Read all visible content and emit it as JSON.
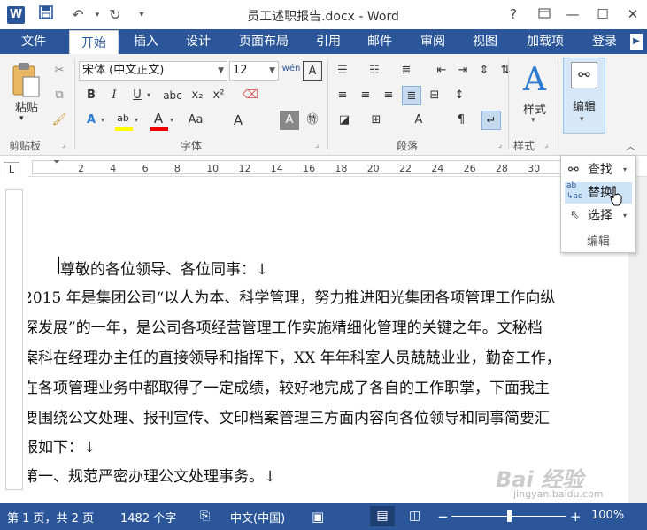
{
  "window": {
    "title": "员工述职报告.docx - Word",
    "help": "?",
    "logo": "W"
  },
  "tabs": [
    {
      "label": "文件"
    },
    {
      "label": "开始"
    },
    {
      "label": "插入"
    },
    {
      "label": "设计"
    },
    {
      "label": "页面布局"
    },
    {
      "label": "引用"
    },
    {
      "label": "邮件"
    },
    {
      "label": "审阅"
    },
    {
      "label": "视图"
    },
    {
      "label": "加载项"
    },
    {
      "label": "登录"
    }
  ],
  "ribbon": {
    "clipboard": {
      "paste": "粘贴",
      "group": "剪贴板"
    },
    "font": {
      "name": "宋体 (中文正文)",
      "size": "12",
      "group": "字体",
      "bold": "B",
      "italic": "I",
      "underline": "U",
      "strike": "abc",
      "sub": "x₂",
      "sup": "x²",
      "effects": "A",
      "highlight": "ab",
      "color": "A",
      "case": "Aa",
      "grow": "A",
      "charshade": "A",
      "enclose": "㊕",
      "wen": "wén",
      "border": "A"
    },
    "paragraph": {
      "group": "段落"
    },
    "styles": {
      "label": "样式",
      "group": "样式"
    },
    "editing": {
      "label": "编辑"
    }
  },
  "dropdown": {
    "find": "查找",
    "replace": "替换",
    "select": "选择",
    "group": "编辑"
  },
  "ruler": {
    "marks": [
      "2",
      "4",
      "6",
      "8",
      "10",
      "12",
      "14",
      "16",
      "18",
      "20",
      "22",
      "24",
      "26",
      "28",
      "30",
      "32",
      "34"
    ],
    "vmarks": [
      "2",
      "1",
      "1",
      "2",
      "3",
      "4",
      "5",
      "6",
      "7",
      "8",
      "9",
      "10"
    ],
    "corner": "L"
  },
  "document": {
    "lines": [
      "尊敬的各位领导、各位同事：↓",
      "2015 年是集团公司“以人为本、科学管理，努力推进阳光集团各项管理工作向纵",
      "深发展”的一年，是公司各项经营管理工作实施精细化管理的关键之年。文秘档",
      "案科在经理办主任的直接领导和指挥下，XX 年年科室人员兢兢业业，勤奋工作，",
      "在各项管理业务中都取得了一定成绩，较好地完成了各自的工作职掌，下面我主",
      "要围绕公文处理、报刊宣传、文印档案管理三方面内容向各位领导和同事简要汇",
      "报如下：↓",
      "第一、规范严密办理公文处理事务。↓"
    ]
  },
  "status": {
    "page": "第 1 页，共 2 页",
    "words": "1482 个字",
    "lang": "中文(中国)",
    "zoom": "100%"
  },
  "watermark": {
    "brand": "Bai 经验",
    "url": "jingyan.baidu.com"
  },
  "colors": {
    "accent": "#2b579a",
    "highlight": "#ffff00",
    "fontcolor": "#ff0000"
  }
}
